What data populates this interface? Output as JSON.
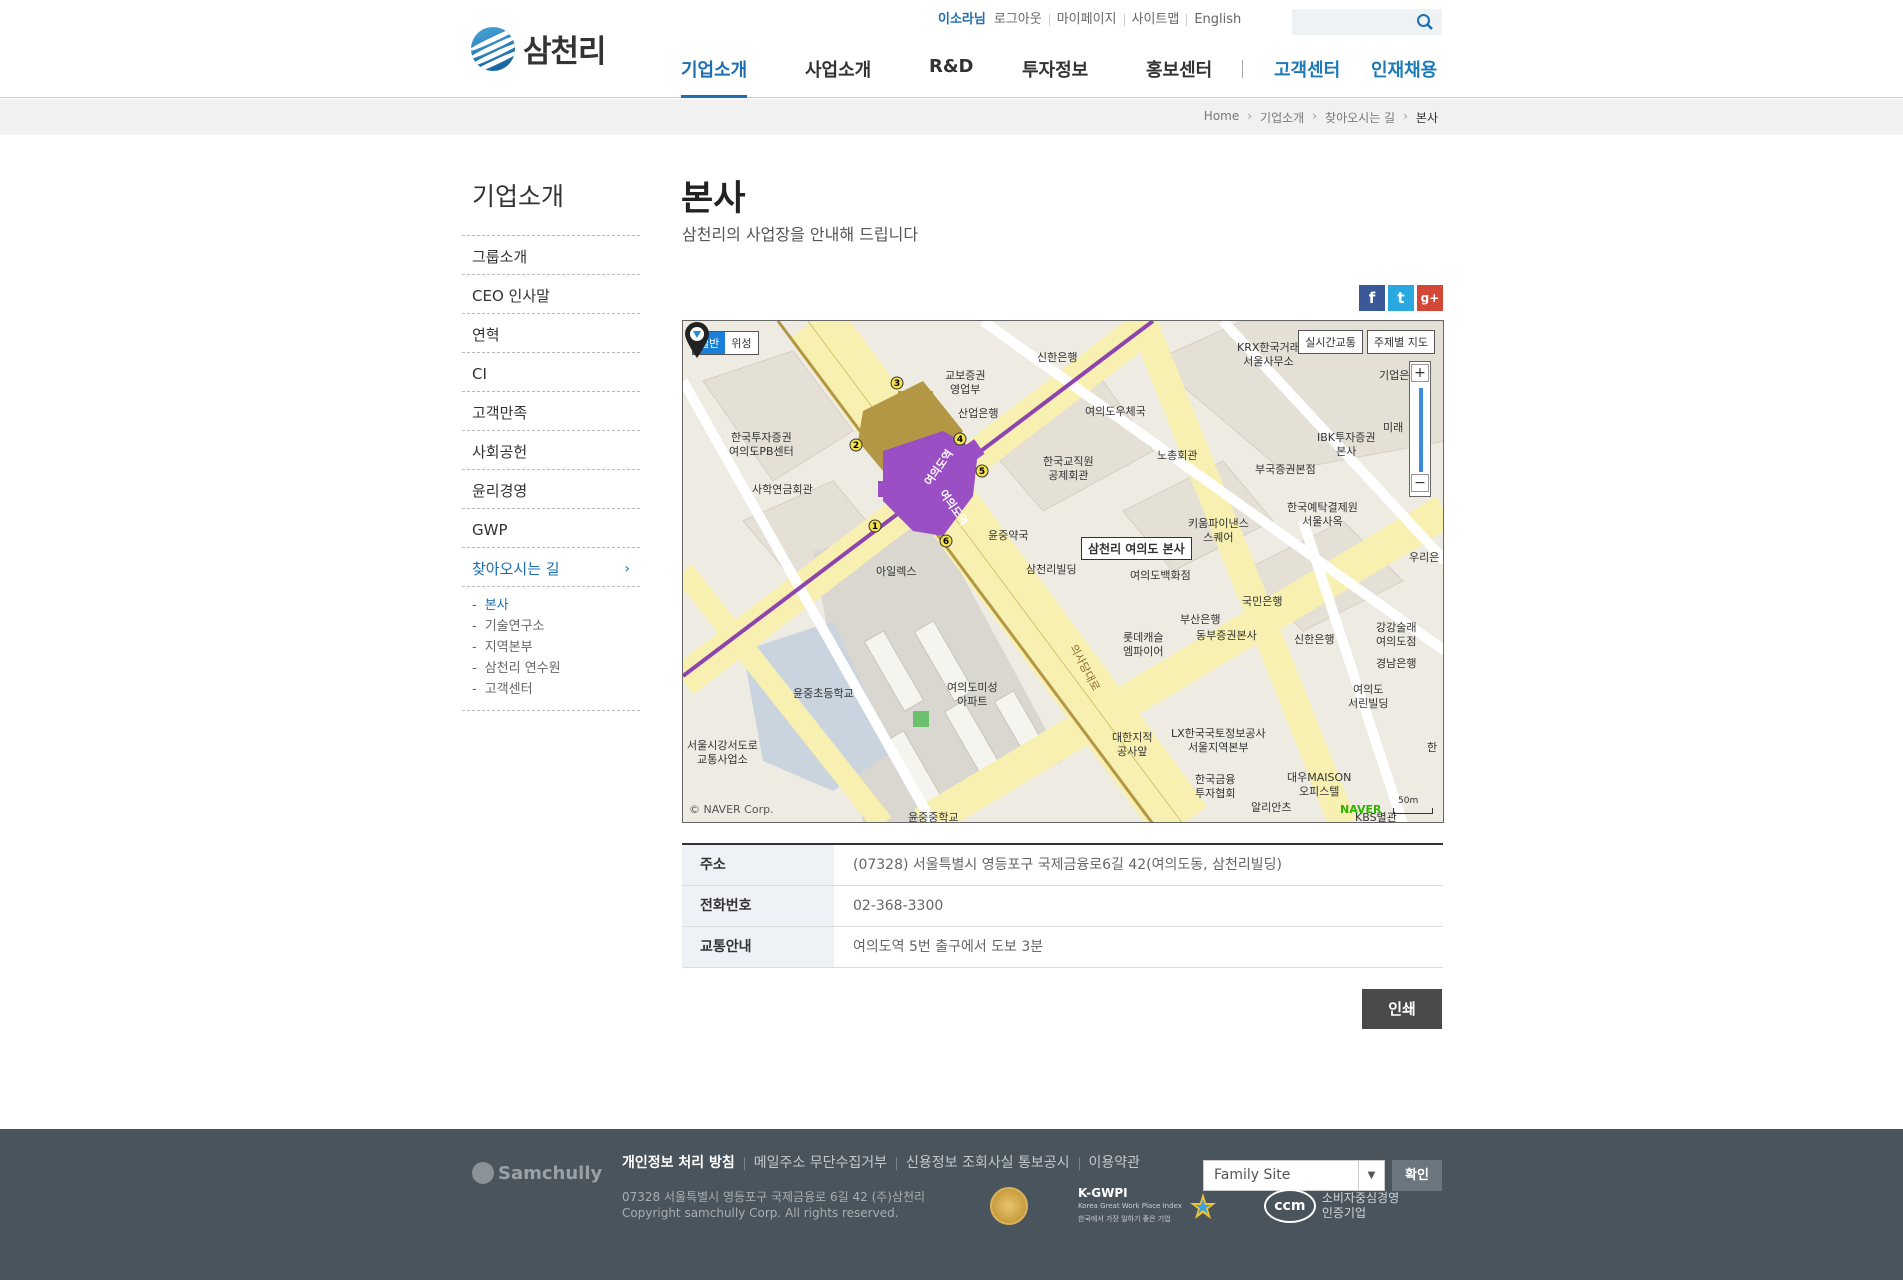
{
  "header": {
    "logo_text": "삼천리",
    "util": {
      "user": "이소라님",
      "logout": "로그아웃",
      "mypage": "마이페이지",
      "sitemap": "사이트맵",
      "english": "English"
    },
    "search_placeholder": "",
    "gnb": [
      "기업소개",
      "사업소개",
      "R&D",
      "투자정보",
      "홍보센터",
      "고객센터",
      "인재채용"
    ]
  },
  "breadcrumb": [
    "Home",
    "기업소개",
    "찾아오시는 길",
    "본사"
  ],
  "lnb": {
    "title": "기업소개",
    "items": [
      "그룹소개",
      "CEO 인사말",
      "연혁",
      "CI",
      "고객만족",
      "사회공헌",
      "윤리경영",
      "GWP",
      "찾아오시는 길"
    ],
    "sub": [
      "본사",
      "기술연구소",
      "지역본부",
      "삼천리 연수원",
      "고객센터"
    ]
  },
  "page": {
    "title": "본사",
    "desc": "삼천리의 사업장을 안내해 드립니다"
  },
  "sns": {
    "facebook": "f",
    "twitter": "t",
    "google": "g+"
  },
  "map": {
    "view_normal": "일반",
    "view_satellite": "위성",
    "btn_traffic": "실시간교통",
    "btn_theme": "주제별 지도",
    "pin_label": "삼천리 여의도 본사",
    "copyright": "© NAVER Corp.",
    "naver": "NAVER",
    "scale": "50m",
    "labels": {
      "krx": "KRX한국거래\n서울사무소",
      "kyobo": "교보증권\n영업부",
      "shinhan1": "신한은행",
      "industrial": "산업은행",
      "ydp_post": "여의도우체국",
      "kitc": "한국투자증권\n여의도PB센터",
      "teachers": "한국교직원\n공제회관",
      "nochong": "노총회관",
      "ibk": "IBK투자증권\n본사",
      "busan_sec": "부국증권본점",
      "sahak": "사학연금회관",
      "kiwoom": "키움파이낸스\n스퀘어",
      "ksd": "한국예탁결제원\n서울사옥",
      "yunjung_pharm": "윤중약국",
      "samchully_bldg": "삼천리빌딩",
      "ydp_dept": "여의도백화점",
      "kookmin": "국민은행",
      "ilex": "아일렉스",
      "busan_bank": "부산은행",
      "dongbu": "동부증권본사",
      "shinhan2": "신한은행",
      "kangnam": "강강술래\n여의도점",
      "kyongnam": "경남은행",
      "lotte": "롯데캐슬\n엠파이어",
      "yunjung_elem": "윤중초등학교",
      "misung": "여의도미성\n아파트",
      "ydp_serin": "여의도\n서린빌딩",
      "kasa": "대한지적\n공사앞",
      "lx": "LX한국국토정보공사\n서울지역본부",
      "gangseo": "서울시강서도로\n교통사업소",
      "kfia": "한국금융\n투자협회",
      "allianz": "알리안츠",
      "daewoo": "대우MAISON\n오피스텔",
      "kbs": "KBS별관",
      "ibk_bank": "기업은",
      "mirae": "미래",
      "woori": "우리은",
      "yunjung_mid": "윤중중학교",
      "station": "여의도역",
      "station2": "여의도역",
      "road": "의사당대로",
      "t_hanguk": "한"
    }
  },
  "info": {
    "rows": [
      {
        "th": "주소",
        "td": "(07328) 서울특별시 영등포구 국제금융로6길 42(여의도동, 삼천리빌딩)"
      },
      {
        "th": "전화번호",
        "td": "02-368-3300"
      },
      {
        "th": "교통안내",
        "td": "여의도역 5번 출구에서 도보 3분"
      }
    ]
  },
  "print_label": "인쇄",
  "footer": {
    "logo": "Samchully",
    "links": [
      "개인정보 처리 방침",
      "메일주소 무단수집거부",
      "신용정보 조회사실 통보공시",
      "이용약관"
    ],
    "address": "07328 서울특별시 영등포구 국제금융로 6길 42 (주)삼천리",
    "copyright": "Copyright samchully Corp. All rights reserved.",
    "family_site": "Family Site",
    "confirm": "확인",
    "kgwpi_title": "K-GWPI",
    "kgwpi_sub": "Korea Great Work Place Index",
    "kgwpi_kor": "한국에서 가장 일하기 좋은 기업",
    "ccm_logo": "ccm",
    "ccm_text": "소비자중심경영\n인증기업"
  }
}
